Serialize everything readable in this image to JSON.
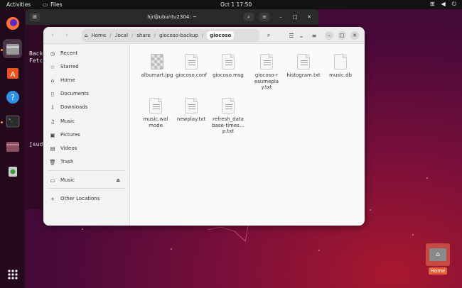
{
  "topbar": {
    "activities": "Activities",
    "app_name": "Files",
    "clock": "Oct 1  17:50"
  },
  "terminal": {
    "title": "hjr@ubuntu2304: ~",
    "line1": "Back",
    "line2": "Fetc",
    "line3": "[sud"
  },
  "files": {
    "path": [
      "Home",
      ".local",
      "share",
      "giocoso-backup",
      "giocoso"
    ],
    "sidebar": [
      {
        "label": "Recent",
        "icon": "clock-icon"
      },
      {
        "label": "Starred",
        "icon": "star-icon"
      },
      {
        "label": "Home",
        "icon": "home-icon"
      },
      {
        "label": "Documents",
        "icon": "document-icon"
      },
      {
        "label": "Downloads",
        "icon": "download-icon"
      },
      {
        "label": "Music",
        "icon": "music-icon"
      },
      {
        "label": "Pictures",
        "icon": "picture-icon"
      },
      {
        "label": "Videos",
        "icon": "video-icon"
      },
      {
        "label": "Trash",
        "icon": "trash-icon"
      },
      {
        "label": "Music",
        "icon": "drive-icon"
      },
      {
        "label": "Other Locations",
        "icon": "plus-icon"
      }
    ],
    "items": [
      "albumart.jpg",
      "giocoso.conf",
      "giocoso.msg",
      "giocoso-resumeplay.txt",
      "histogram.txt",
      "music.db",
      "music.walmode",
      "newplay.txt",
      "refresh_database-times…p.txt"
    ]
  },
  "desktop": {
    "home_label": "Home"
  }
}
